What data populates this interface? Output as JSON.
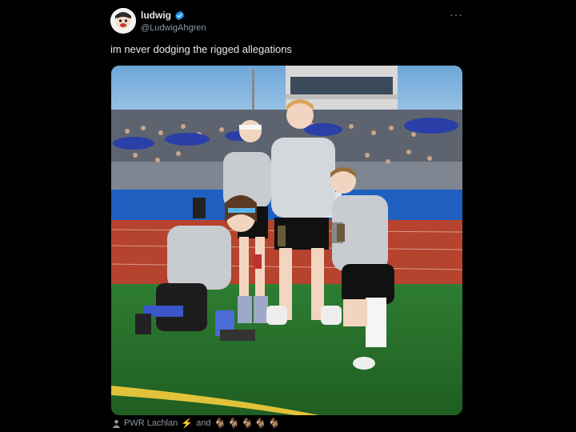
{
  "tweet": {
    "display_name": "ludwig",
    "handle": "@LudwigAhgren",
    "more_label": "···",
    "text": "im never dodging the rigged allegations"
  },
  "tags": {
    "first": "PWR Lachlan",
    "bolt": "⚡",
    "and_label": "and",
    "goats": "🐐🐐🐐🐐🐐"
  },
  "colors": {
    "background": "#000000",
    "text_primary": "#e7e9ea",
    "text_secondary": "#8b98a5",
    "verified": "#1d9bf0"
  },
  "icons": [
    "avatar",
    "verified-badge-icon",
    "more-options-icon",
    "person-tag-icon"
  ]
}
